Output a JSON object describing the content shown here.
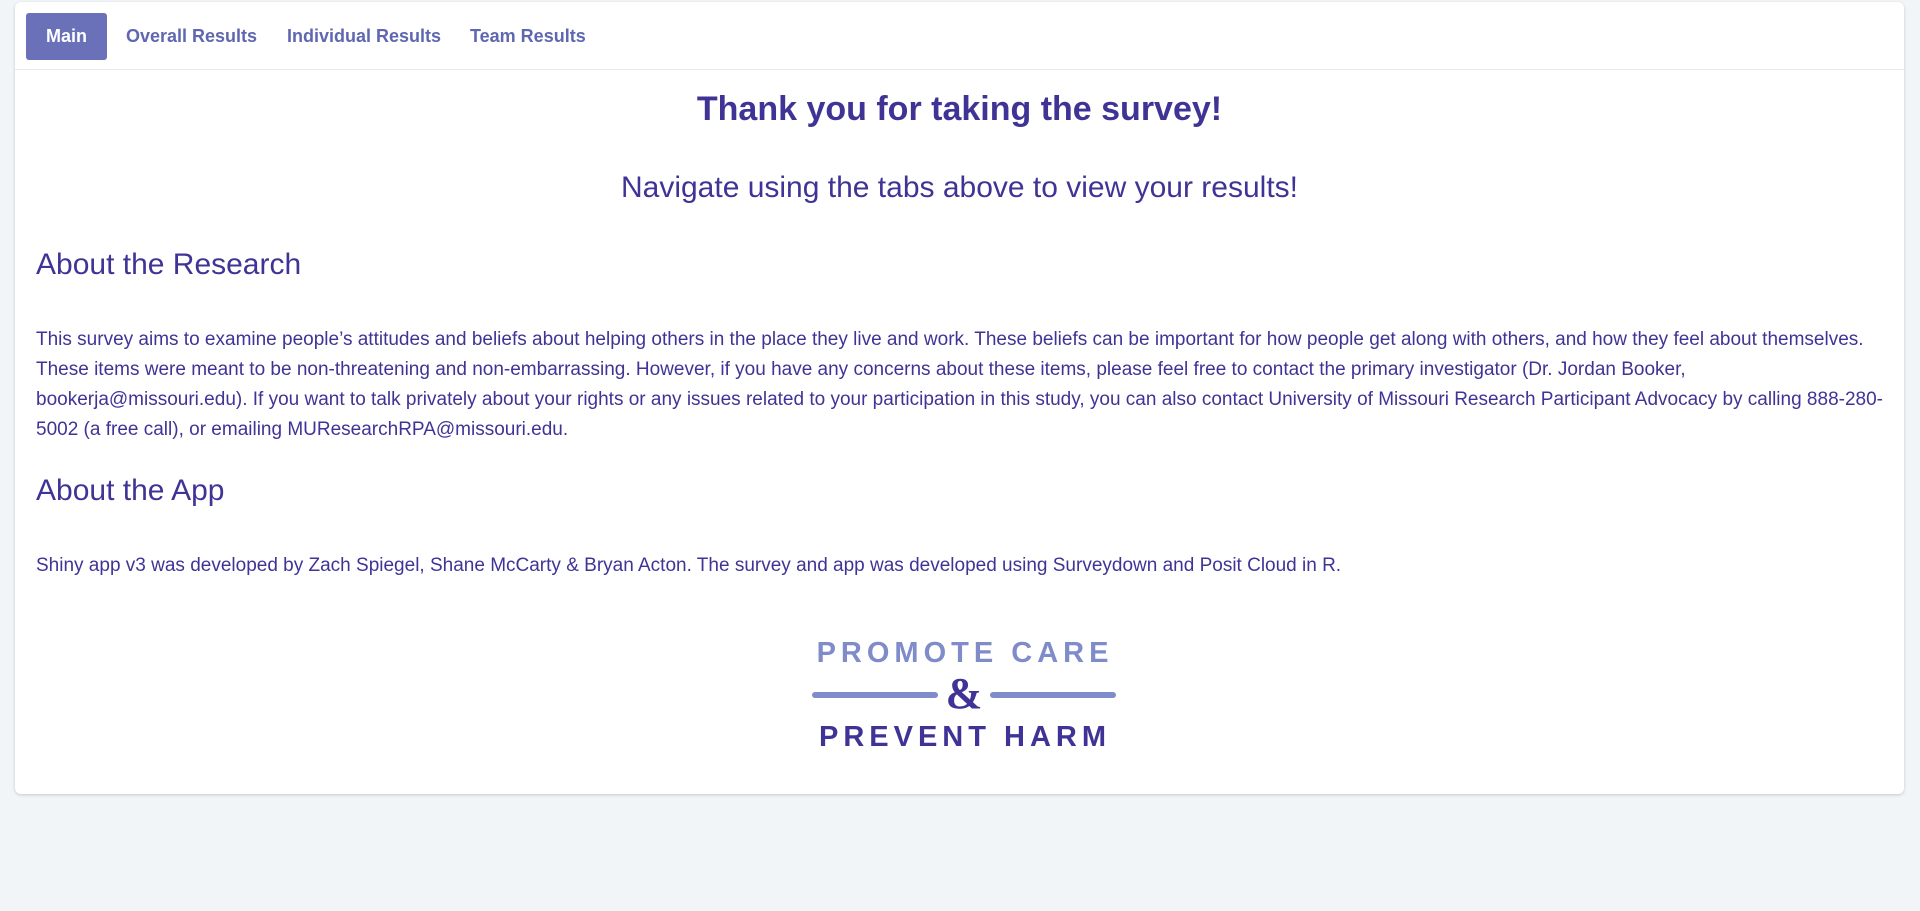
{
  "tabs": [
    {
      "label": "Main",
      "active": true
    },
    {
      "label": "Overall Results",
      "active": false
    },
    {
      "label": "Individual Results",
      "active": false
    },
    {
      "label": "Team Results",
      "active": false
    }
  ],
  "main": {
    "title": "Thank you for taking the survey!",
    "subtitle": "Navigate using the tabs above to view your results!",
    "research_heading": "About the Research",
    "research_text": "This survey aims to examine people’s attitudes and beliefs about helping others in the place they live and work. These beliefs can be important for how people get along with others, and how they feel about themselves. These items were meant to be non-threatening and non-embarrassing. However, if you have any concerns about these items, please feel free to contact the primary investigator (Dr. Jordan Booker, bookerja@missouri.edu). If you want to talk privately about your rights or any issues related to your participation in this study, you can also contact University of Missouri Research Participant Advocacy by calling 888-280-5002 (a free call), or emailing MUResearchRPA@missouri.edu.",
    "app_heading": "About the App",
    "app_text": "Shiny app v3 was developed by Zach Spiegel, Shane McCarty & Bryan Acton. The survey and app was developed using Surveydown and Posit Cloud in R."
  },
  "logo": {
    "line1": "PROMOTE CARE",
    "ampersand": "&",
    "line2": "PREVENT HARM"
  },
  "colors": {
    "text": "#3f3496",
    "tab_active_bg": "#6b71b8",
    "tab_text": "#5f67b0",
    "logo_light": "#7f8cc9",
    "logo_dark": "#3f3496",
    "page_bg": "#f2f5f8"
  }
}
